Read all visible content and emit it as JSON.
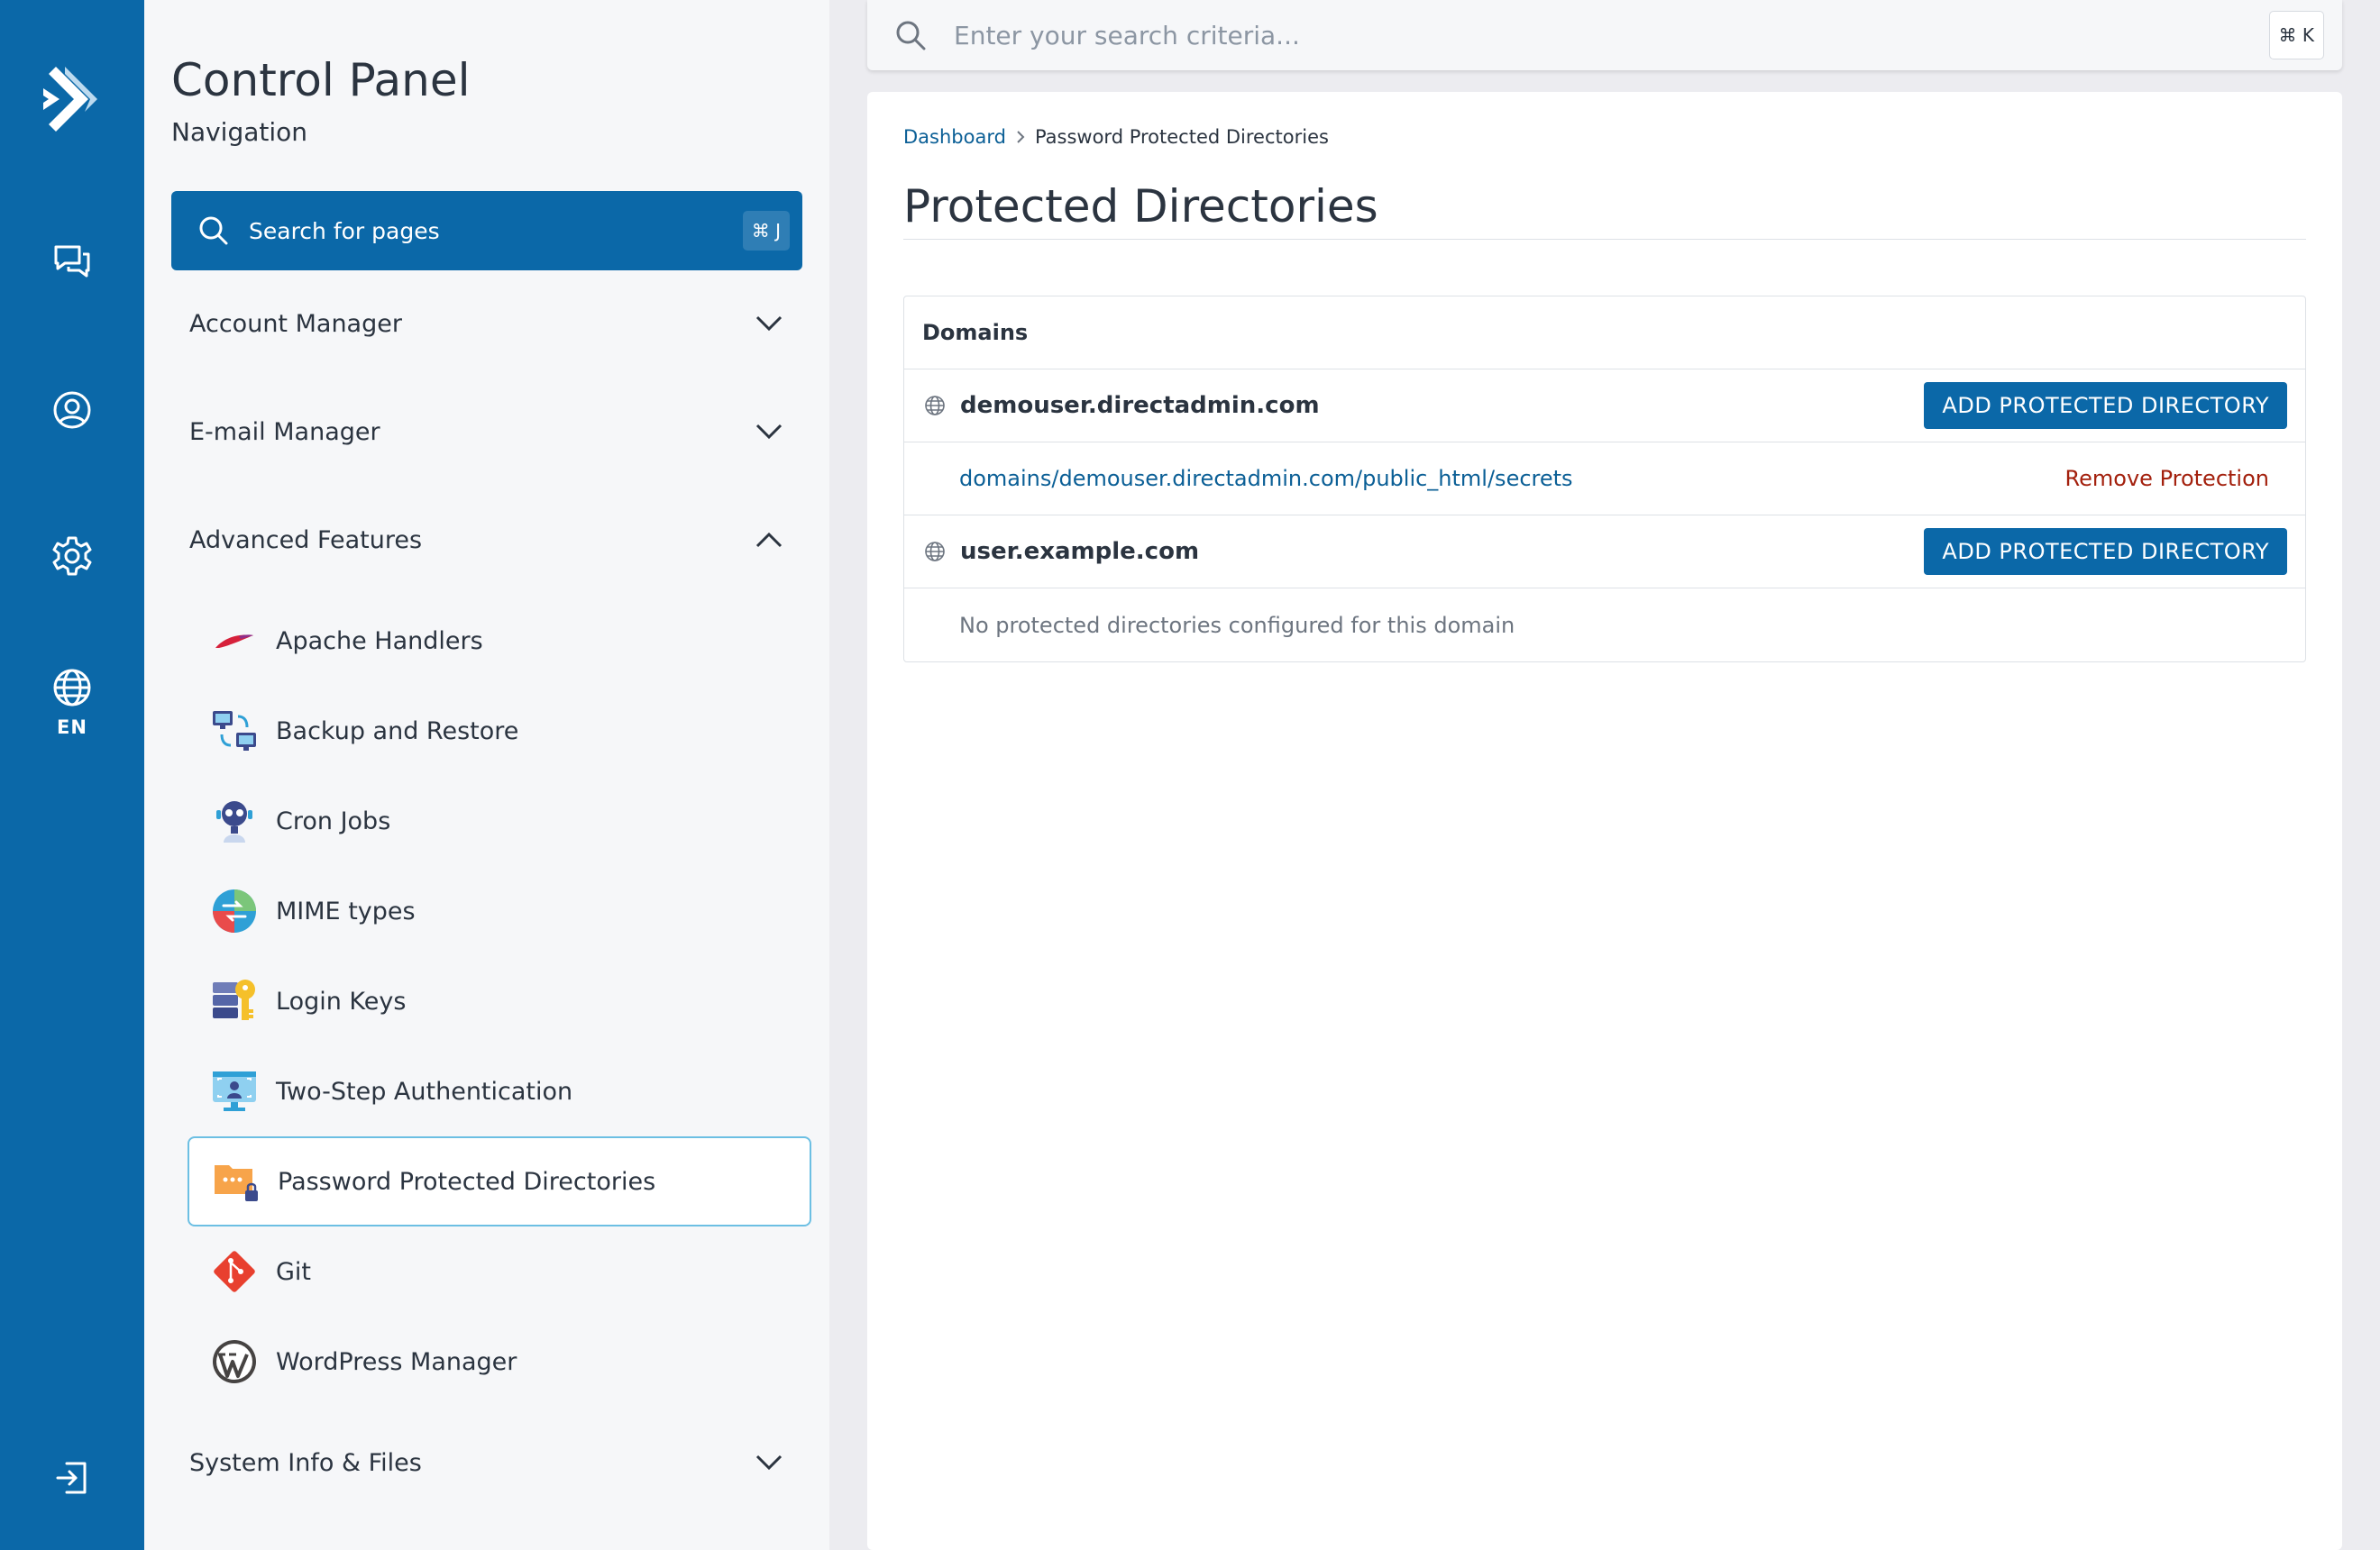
{
  "rail": {
    "language": "EN",
    "icons": [
      "logo-icon",
      "messages-icon",
      "user-icon",
      "settings-icon",
      "globe-icon",
      "logout-icon"
    ]
  },
  "nav": {
    "title": "Control Panel",
    "subtitle": "Navigation",
    "search_label": "Search for pages",
    "search_shortcut": "⌘ J",
    "sections": {
      "account": "Account Manager",
      "email": "E-mail Manager",
      "advanced": "Advanced Features",
      "system": "System Info & Files"
    },
    "advanced_items": [
      {
        "label": "Apache Handlers",
        "icon": "feather-icon"
      },
      {
        "label": "Backup and Restore",
        "icon": "backup-icon"
      },
      {
        "label": "Cron Jobs",
        "icon": "robot-icon"
      },
      {
        "label": "MIME types",
        "icon": "mime-icon"
      },
      {
        "label": "Login Keys",
        "icon": "key-icon"
      },
      {
        "label": "Two-Step Authentication",
        "icon": "two-step-icon"
      },
      {
        "label": "Password Protected Directories",
        "icon": "folder-lock-icon"
      },
      {
        "label": "Git",
        "icon": "git-icon"
      },
      {
        "label": "WordPress Manager",
        "icon": "wordpress-icon"
      }
    ]
  },
  "topsearch": {
    "placeholder": "Enter your search criteria...",
    "shortcut": "⌘ K"
  },
  "main": {
    "breadcrumb": {
      "home": "Dashboard",
      "current": "Password Protected Directories"
    },
    "title": "Protected Directories",
    "table": {
      "header": "Domains",
      "add_button_label": "ADD PROTECTED DIRECTORY",
      "domains": [
        {
          "name": "demouser.directadmin.com",
          "path": "domains/demouser.directadmin.com/public_html/secrets",
          "remove_label": "Remove Protection"
        },
        {
          "name": "user.example.com",
          "empty_message": "No protected directories configured for this domain"
        }
      ]
    }
  },
  "colors": {
    "primary": "#0b68a8",
    "link": "#0b5f96",
    "danger": "#a3200d",
    "active_border": "#6cbfe3"
  }
}
